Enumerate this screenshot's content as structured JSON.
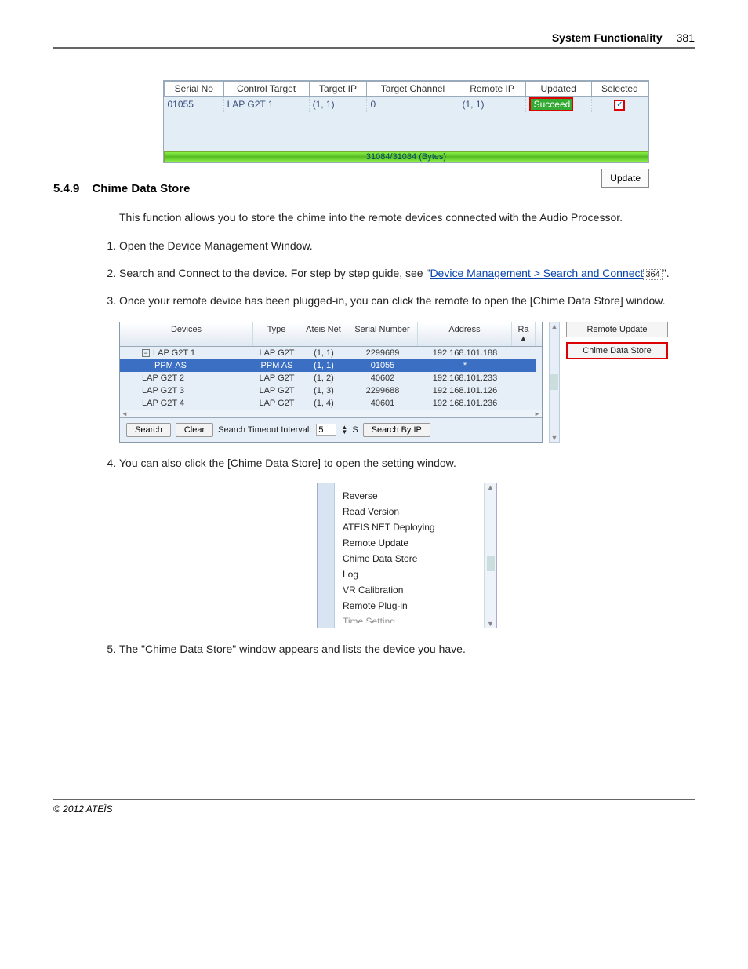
{
  "header": {
    "title": "System Functionality",
    "page": "381"
  },
  "table1": {
    "cols": [
      "Serial No",
      "Control Target",
      "Target IP",
      "Target Channel",
      "Remote IP",
      "Updated",
      "Selected"
    ],
    "row": {
      "serial": "01055",
      "ct": "LAP G2T 1",
      "tip": "(1, 1)",
      "tc": "0",
      "rip": "(1, 1)",
      "upd": "Succeed"
    }
  },
  "progress": {
    "text": "31084/31084 (Bytes)",
    "btn": "Update"
  },
  "section": {
    "num": "5.4.9",
    "title": "Chime Data Store"
  },
  "intro": "This function allows you to store the chime into the remote devices connected with the Audio Processor.",
  "steps": {
    "s1": "Open the Device Management Window.",
    "s2a": "Search and Connect to the device. For step by step guide, see \"",
    "s2link": "Device Management > Search and Connect",
    "s2pn": "364",
    "s2b": "\".",
    "s3": "Once your remote device has been plugged-in, you can click the remote to open the [Chime Data Store] window.",
    "s4": "You can also click the [Chime Data Store] to open the setting window.",
    "s5": "The \"Chime Data Store\" window appears and lists the device you have."
  },
  "dm": {
    "cols": [
      "Devices",
      "Type",
      "Ateis Net",
      "Serial Number",
      "Address",
      "Ra"
    ],
    "rows": [
      {
        "dev": "LAP G2T 1",
        "type": "LAP G2T",
        "an": "(1, 1)",
        "sn": "2299689",
        "addr": "192.168.101.188",
        "tree": true
      },
      {
        "dev": "PPM AS",
        "type": "PPM AS",
        "an": "(1, 1)",
        "sn": "01055",
        "addr": "*",
        "sel": true,
        "child": true
      },
      {
        "dev": "LAP G2T 2",
        "type": "LAP G2T",
        "an": "(1, 2)",
        "sn": "40602",
        "addr": "192.168.101.233"
      },
      {
        "dev": "LAP G2T 3",
        "type": "LAP G2T",
        "an": "(1, 3)",
        "sn": "2299688",
        "addr": "192.168.101.126"
      },
      {
        "dev": "LAP G2T 4",
        "type": "LAP G2T",
        "an": "(1, 4)",
        "sn": "40601",
        "addr": "192.168.101.236"
      }
    ],
    "search": "Search",
    "clear": "Clear",
    "stil": "Search Timeout Interval:",
    "stv": "5",
    "s": "S",
    "sbip": "Search By IP"
  },
  "side": {
    "ru": "Remote Update",
    "cds": "Chime Data Store"
  },
  "menu": [
    "Reverse",
    "Read Version",
    "ATEIS NET Deploying",
    "Remote Update",
    "Chime Data Store",
    "Log",
    "VR Calibration",
    "Remote Plug-in",
    "Time Setting"
  ],
  "footer": "© 2012 ATEÏS"
}
